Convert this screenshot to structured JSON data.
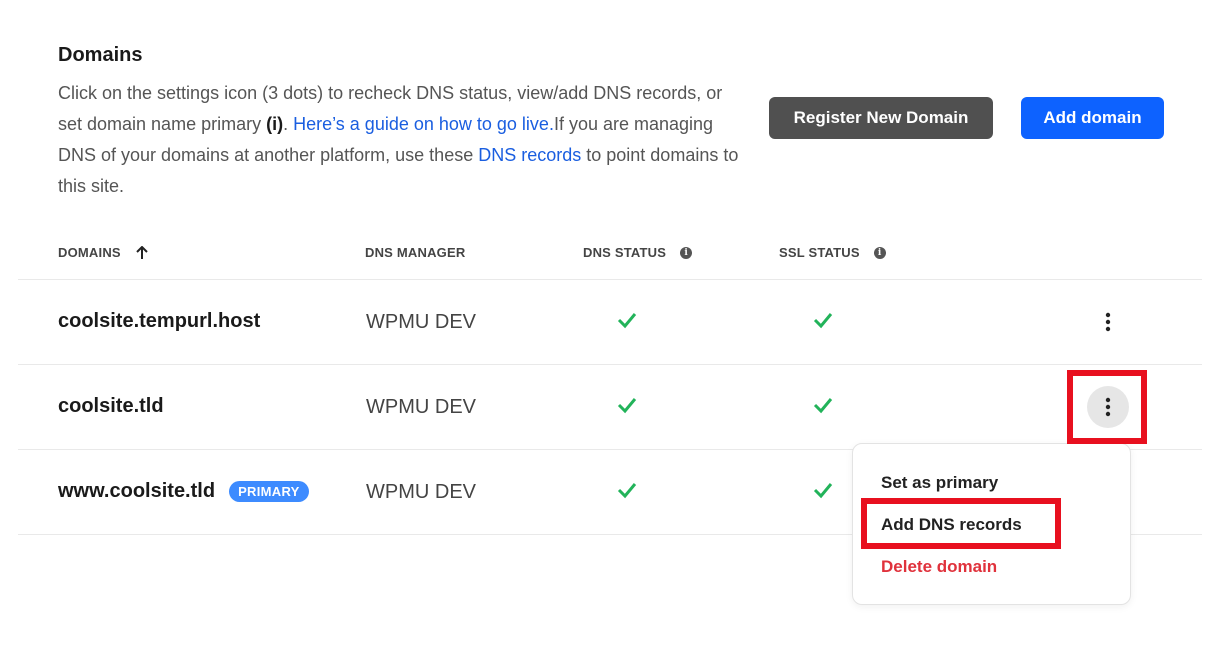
{
  "header": {
    "title": "Domains",
    "desc_part1": "Click on the settings icon (3 dots) to recheck DNS status, view/add DNS records, or set domain name primary ",
    "desc_bold": "(i)",
    "desc_part2": ". ",
    "guide_link": "Here’s a guide on how to go live.",
    "desc_part3": "If you are managing DNS of your domains at another platform, use these ",
    "dns_link": "DNS records",
    "desc_part4": " to point domains to this site."
  },
  "buttons": {
    "register": "Register New Domain",
    "add": "Add domain"
  },
  "table": {
    "columns": {
      "domains": "DOMAINS",
      "dns_manager": "DNS MANAGER",
      "dns_status": "DNS STATUS",
      "ssl_status": "SSL STATUS"
    },
    "rows": [
      {
        "domain": "coolsite.tempurl.host",
        "manager": "WPMU DEV",
        "dns_ok": true,
        "ssl_ok": true
      },
      {
        "domain": "coolsite.tld",
        "manager": "WPMU DEV",
        "dns_ok": true,
        "ssl_ok": true
      },
      {
        "domain": "www.coolsite.tld",
        "badge": "PRIMARY",
        "manager": "WPMU DEV",
        "dns_ok": true,
        "ssl_ok": true
      }
    ]
  },
  "menu": {
    "set_primary": "Set as primary",
    "add_dns": "Add DNS records",
    "delete": "Delete domain"
  },
  "colors": {
    "primary": "#0d62ff",
    "check": "#22b35a",
    "danger": "#e0323c",
    "highlight": "#e8101f"
  }
}
